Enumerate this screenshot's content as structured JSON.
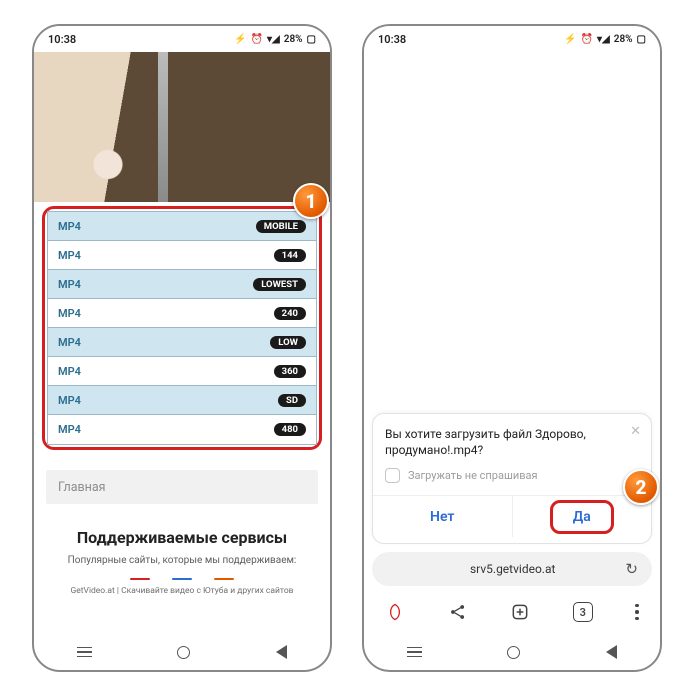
{
  "status": {
    "time": "10:38",
    "battery": "28%",
    "signal": "⚡ ⏰ 📶 ◢"
  },
  "left": {
    "step": "1",
    "formats": [
      {
        "fmt": "MP4",
        "quality": "MOBILE"
      },
      {
        "fmt": "MP4",
        "quality": "144"
      },
      {
        "fmt": "MP4",
        "quality": "LOWEST"
      },
      {
        "fmt": "MP4",
        "quality": "240"
      },
      {
        "fmt": "MP4",
        "quality": "LOW"
      },
      {
        "fmt": "MP4",
        "quality": "360"
      },
      {
        "fmt": "MP4",
        "quality": "SD"
      },
      {
        "fmt": "MP4",
        "quality": "480"
      }
    ],
    "home_label": "Главная",
    "services_heading": "Поддерживаемые сервисы",
    "services_sub": "Популярные сайты, которые мы поддерживаем:",
    "footer_note": "GetVideo.at | Скачивайте видео с Ютуба и других сайтов",
    "dash_colors": [
      "#d61f1f",
      "#2b6bd4",
      "#e25a00"
    ]
  },
  "right": {
    "step": "2",
    "dialog_text": "Вы хотите загрузить файл Здорово, продумано!.mp4?",
    "dont_ask_label": "Загружать не спрашивая",
    "no_label": "Нет",
    "yes_label": "Да",
    "url": "srv5.getvideo.at",
    "tab_count": "3"
  }
}
